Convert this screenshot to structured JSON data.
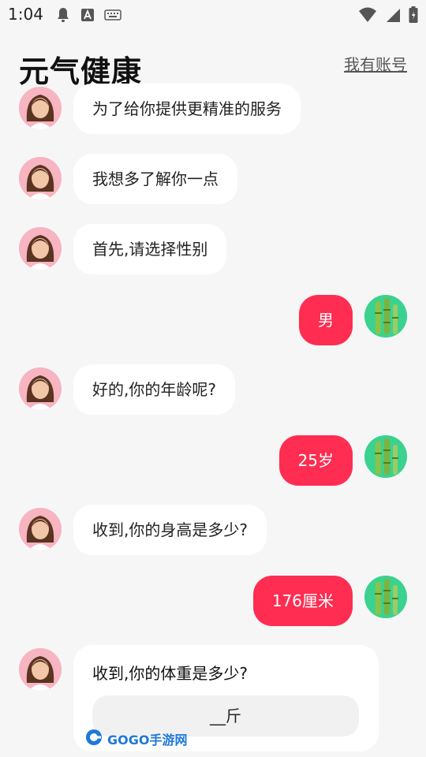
{
  "status_bar": {
    "time": "1:04"
  },
  "header": {
    "title": "元气健康",
    "account_link": "我有账号"
  },
  "messages": {
    "m1": "为了给你提供更精准的服务",
    "m2": "我想多了解你一点",
    "m3": "首先,请选择性别",
    "r1": "男",
    "m4": "好的,你的年龄呢?",
    "r2": "25岁",
    "m5": "收到,你的身高是多少?",
    "r3": "176厘米",
    "m6": "收到,你的体重是多少?"
  },
  "weight_input": {
    "value": "__斤"
  },
  "watermark": {
    "text": "GOGO手游网"
  },
  "colors": {
    "accent": "#ff2d51",
    "background": "#f6f6f6",
    "bubble": "#ffffff"
  },
  "icons": [
    "notification-bell-icon",
    "font-a-icon",
    "keyboard-icon",
    "wifi-icon",
    "signal-icon",
    "battery-icon",
    "bot-avatar",
    "user-avatar-bamboo"
  ]
}
